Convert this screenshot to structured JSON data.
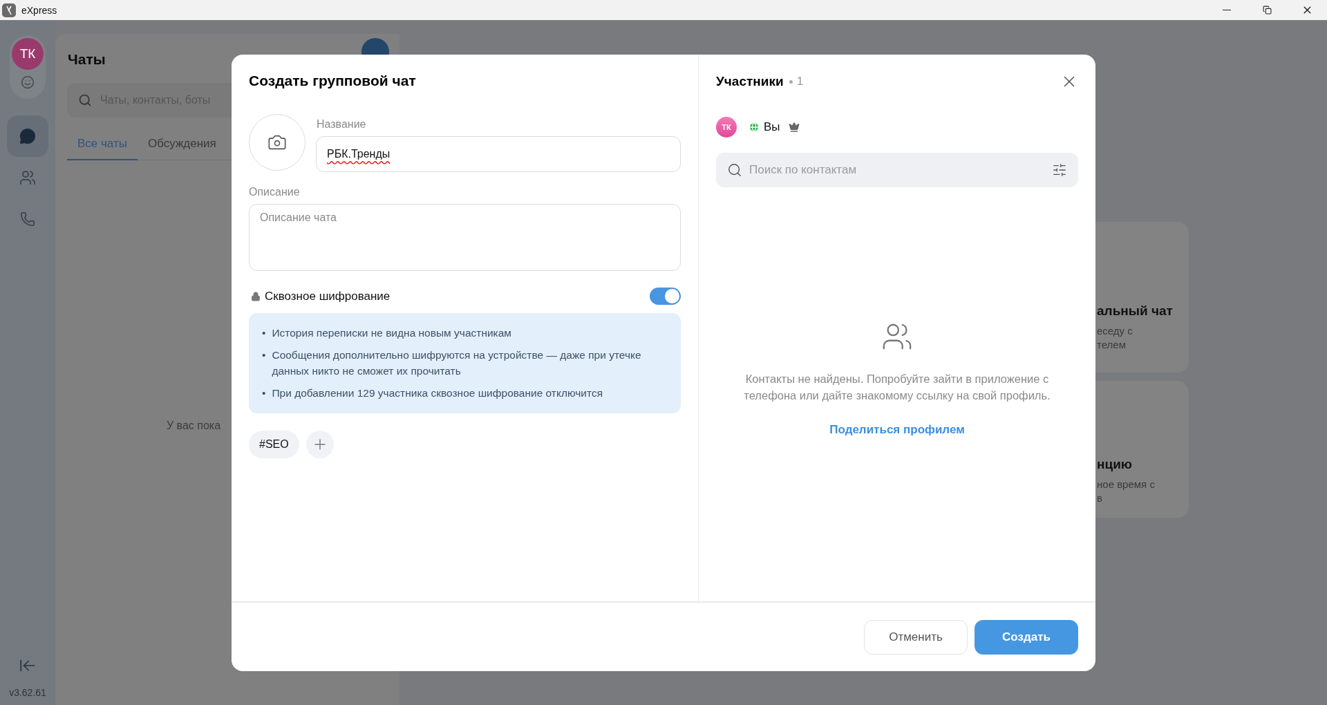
{
  "window": {
    "title": "eXpress"
  },
  "rail": {
    "avatar": "ТК",
    "items": [
      {
        "kind": "chats",
        "selected": true
      },
      {
        "kind": "contacts",
        "selected": false
      },
      {
        "kind": "calls",
        "selected": false
      }
    ],
    "version": "v3.62.61"
  },
  "chat_list": {
    "title": "Чаты",
    "search": {
      "placeholder": "Чаты, контакты, боты"
    },
    "tabs": [
      {
        "label": "Все чаты",
        "selected": true
      },
      {
        "label": "Обсуждения",
        "selected": false
      }
    ],
    "empty_text": "У вас пока"
  },
  "background_cards": [
    {
      "title": "альный чат",
      "lines": [
        "еседу с",
        "телем"
      ]
    },
    {
      "title": "нцию",
      "lines": [
        "ное время с",
        "в"
      ]
    }
  ],
  "dialog": {
    "title": "Создать групповой чат",
    "name_field": {
      "label": "Название",
      "value": "РБК.Тренды",
      "misspelled": true
    },
    "description_field": {
      "label": "Описание",
      "placeholder": "Описание чата"
    },
    "encryption": {
      "label": "Сквозное шифрование",
      "on": true,
      "bullet": "•",
      "notes": [
        "История переписки не видна новым участникам",
        "Сообщения дополнительно шифруются на устройстве — даже при утечке данных никто не сможет их прочитать",
        "При добавлении 129 участника сквозное шифрование отключится"
      ]
    },
    "tags": [
      "#SEO"
    ],
    "participants": {
      "title": "Участники",
      "count": "1",
      "members": [
        {
          "avatar": "ТК",
          "name": "Вы",
          "globe": true,
          "owner": true
        }
      ],
      "search": {
        "placeholder": "Поиск по контактам"
      },
      "empty_text": "Контакты не найдены. Попробуйте зайти в приложение с телефона или дайте знакомому ссылку на свой профиль.",
      "share_link": "Поделиться профилем"
    },
    "buttons": [
      {
        "label": "Отменить",
        "kind": "secondary"
      },
      {
        "label": "Создать",
        "kind": "primary"
      }
    ]
  }
}
